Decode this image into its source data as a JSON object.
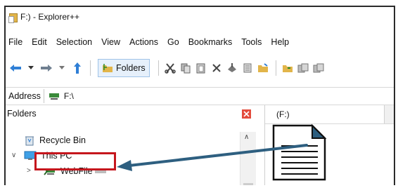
{
  "window": {
    "title": "F:) - Explorer++"
  },
  "menu": [
    "File",
    "Edit",
    "Selection",
    "View",
    "Actions",
    "Go",
    "Bookmarks",
    "Tools",
    "Help"
  ],
  "toolbar": {
    "folders_label": "Folders"
  },
  "address": {
    "label": "Address",
    "value": "F:\\"
  },
  "folders_panel": {
    "title": "Folders",
    "items": [
      {
        "label": "Recycle Bin"
      },
      {
        "label": "This PC"
      },
      {
        "label": "WebFile"
      }
    ]
  },
  "tab": {
    "label": "(F:)"
  },
  "colors": {
    "highlight": "#c5161d",
    "arrow": "#2e5f80",
    "folder": "#e2b54a",
    "drive_icon": "#3a8a3a"
  },
  "icons": [
    "back-arrow-icon",
    "forward-arrow-icon",
    "up-arrow-icon",
    "folders-icon",
    "cut-icon",
    "copy-icon",
    "paste-icon",
    "delete-icon",
    "properties-icon",
    "new-folder-icon",
    "recycle-bin-icon",
    "this-pc-icon",
    "network-drive-icon",
    "document-icon",
    "close-icon",
    "scroll-up-icon"
  ]
}
